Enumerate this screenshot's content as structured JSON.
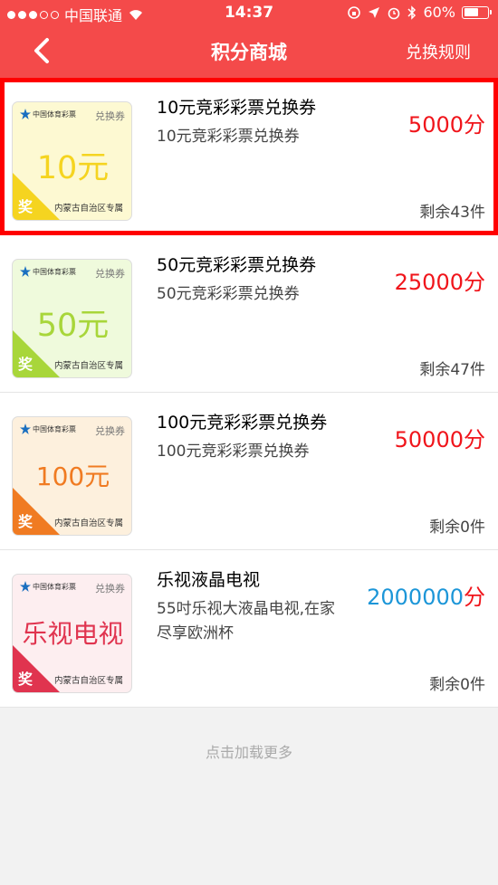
{
  "status": {
    "carrier": "中国联通",
    "time": "14:37",
    "battery": "60%"
  },
  "nav": {
    "title": "积分商城",
    "rules": "兑换规则"
  },
  "items": [
    {
      "name": "10元竞彩彩票兑换券",
      "desc": "10元竞彩彩票兑换券",
      "price": "5000",
      "unit": "分",
      "remain": "剩余43件",
      "ticket": {
        "label": "兑换券",
        "amount": "10元",
        "region": "内蒙古自治区专属",
        "prize": "奖",
        "logo": "中国体育彩票",
        "logo_en": "CHINA SPORTS LOTTERY",
        "bg": "#fdf9d2",
        "amount_color": "#f5d420",
        "tri_color": "#f5d420"
      }
    },
    {
      "name": "50元竞彩彩票兑换券",
      "desc": "50元竞彩彩票兑换券",
      "price": "25000",
      "unit": "分",
      "remain": "剩余47件",
      "ticket": {
        "label": "兑换券",
        "amount": "50元",
        "region": "内蒙古自治区专属",
        "prize": "奖",
        "logo": "中国体育彩票",
        "logo_en": "CHINA SPORTS LOTTERY",
        "bg": "#effadc",
        "amount_color": "#a8d63a",
        "tri_color": "#a8d63a"
      }
    },
    {
      "name": "100元竞彩彩票兑换券",
      "desc": "100元竞彩彩票兑换券",
      "price": "50000",
      "unit": "分",
      "remain": "剩余0件",
      "ticket": {
        "label": "兑换券",
        "amount": "100元",
        "region": "内蒙古自治区专属",
        "prize": "奖",
        "logo": "中国体育彩票",
        "logo_en": "CHINA SPORTS LOTTERY",
        "bg": "#fdf0dd",
        "amount_color": "#f07b22",
        "tri_color": "#f07b22"
      }
    },
    {
      "name": "乐视液晶电视",
      "desc": "55吋乐视大液晶电视,在家尽享欧洲杯",
      "price": "2000000",
      "unit": "分",
      "remain": "剩余0件",
      "ticket": {
        "label": "兑换券",
        "amount": "乐视电视",
        "region": "内蒙古自治区专属",
        "prize": "奖",
        "logo": "中国体育彩票",
        "logo_en": "CHINA SPORTS LOTTERY",
        "bg": "#fdeef0",
        "amount_color": "#e0344f",
        "tri_color": "#e0344f"
      }
    }
  ],
  "price_colors": [
    "#f0151b",
    "#f0151b",
    "#f0151b",
    "#1c96d8"
  ],
  "load_more": "点击加载更多"
}
